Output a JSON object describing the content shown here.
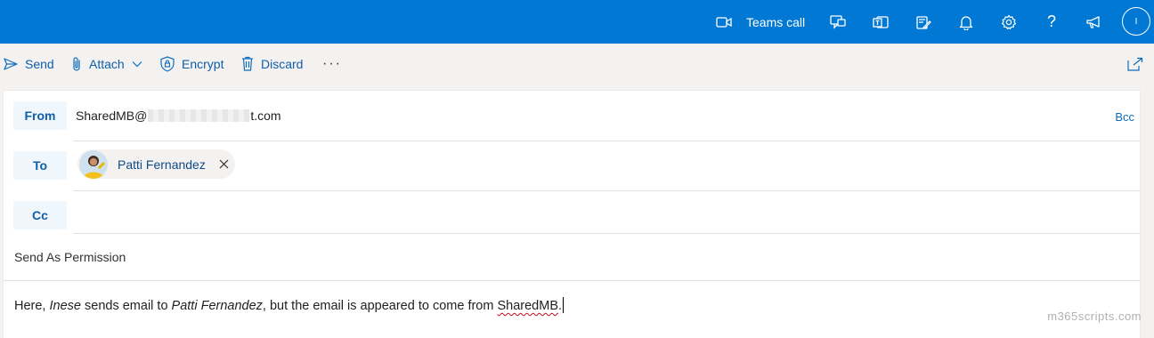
{
  "topbar": {
    "teams_call_label": "Teams call",
    "avatar_initial": "I",
    "icons": [
      "video-icon",
      "chat-icon",
      "teams-icon",
      "tasks-icon",
      "bell-icon",
      "gear-icon",
      "help-icon",
      "megaphone-icon"
    ]
  },
  "commands": {
    "send": "Send",
    "attach": "Attach",
    "encrypt": "Encrypt",
    "discard": "Discard",
    "more": "···"
  },
  "compose": {
    "from_label": "From",
    "from_prefix": "SharedMB@",
    "from_suffix": "t.com",
    "bcc_label": "Bcc",
    "to_label": "To",
    "recipient_name": "Patti Fernandez",
    "cc_label": "Cc",
    "subject": "Send As Permission",
    "body": {
      "part1": "Here, ",
      "part2": "Inese",
      "part3": " sends email to ",
      "part4": "Patti Fernandez",
      "part5": ", but the email is appeared to come from ",
      "part6": "SharedMB",
      "part7": "."
    }
  },
  "watermark": "m365scripts.com",
  "colors": {
    "brand": "#0078d4",
    "link": "#0f6cbd",
    "field_bg": "#eff6fc"
  }
}
